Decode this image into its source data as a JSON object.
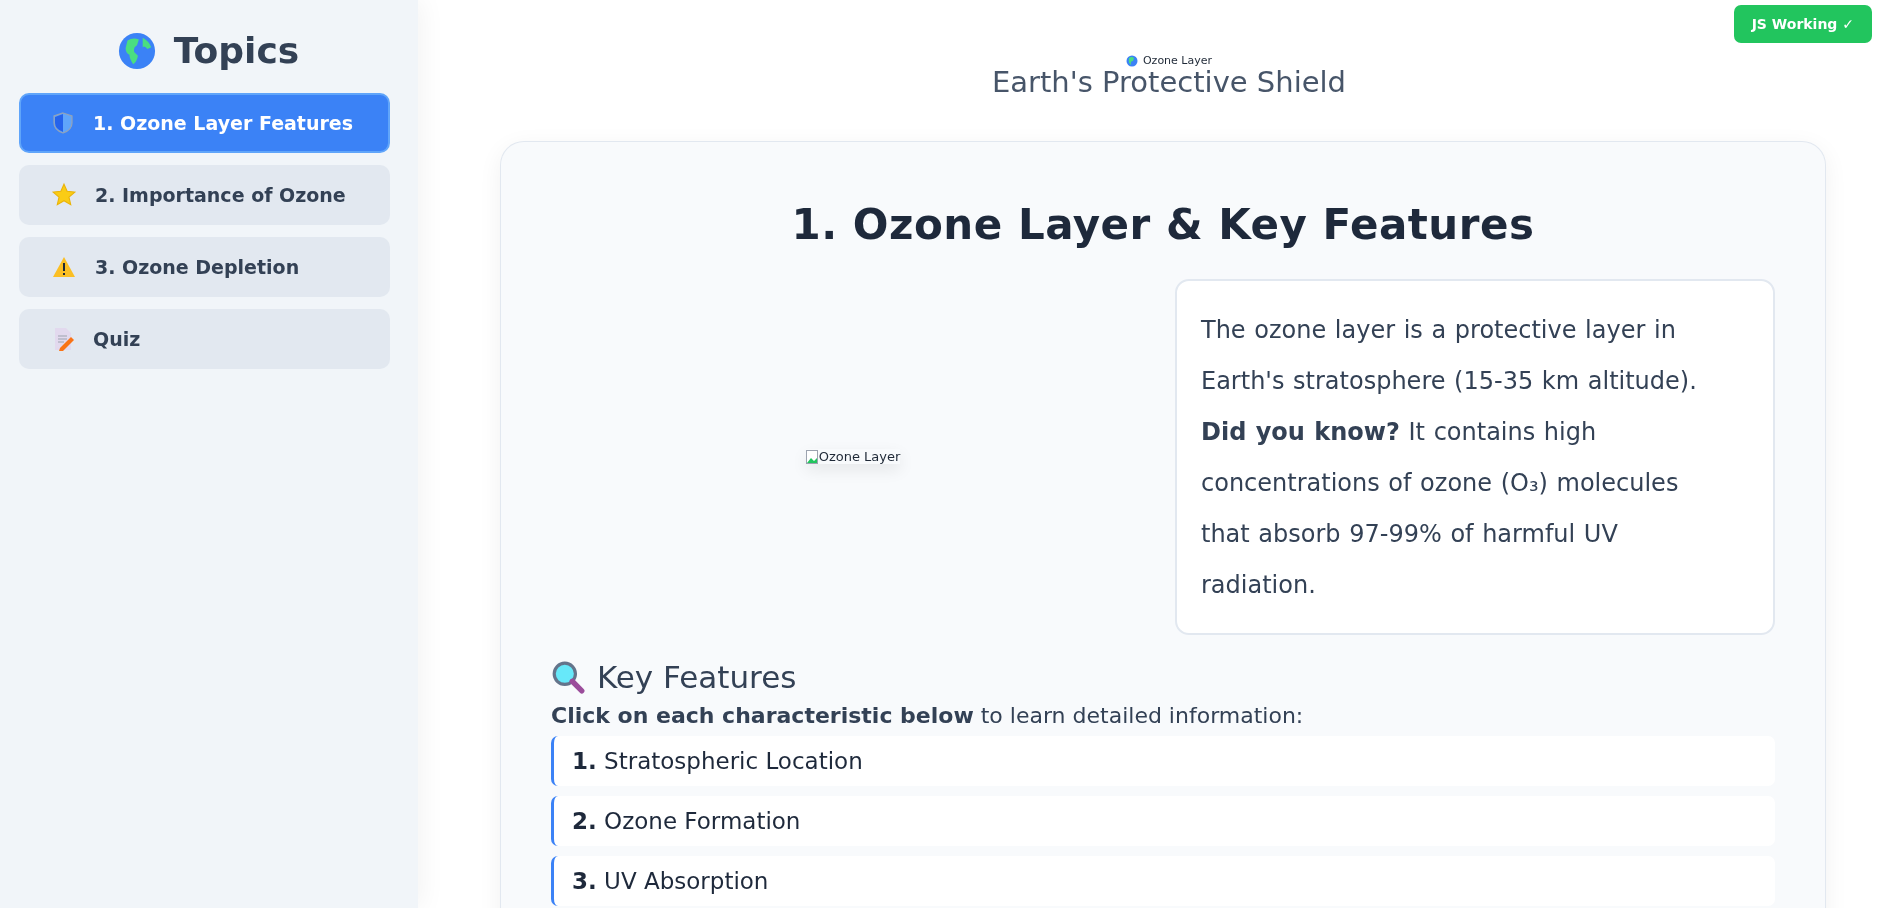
{
  "sidebar": {
    "title": "Topics",
    "items": [
      {
        "label": "1. Ozone Layer Features",
        "kind": "shield",
        "selected": true
      },
      {
        "label": "2. Importance of Ozone",
        "kind": "star",
        "selected": false
      },
      {
        "label": "3. Ozone Depletion",
        "kind": "warning",
        "selected": false
      },
      {
        "label": "Quiz",
        "kind": "memo",
        "selected": false
      }
    ]
  },
  "status_badge": "JS Working ✓",
  "header": {
    "image_alt": "Ozone Layer",
    "title": "Earth's Protective Shield"
  },
  "section": {
    "title": "1. Ozone Layer & Key Features",
    "image_alt": "Ozone Layer",
    "info": "The ozone layer is a protective layer in Earth's stratosphere (15-35 km altitude). **Did you know?** It contains high concentrations of ozone (O₃) molecules that absorb 97-99% of harmful UV radiation.",
    "features_title": "Key Features",
    "instruction": "**Click on each characteristic below** to learn detailed information:",
    "features": [
      {
        "number": "1.",
        "label": "Stratospheric Location"
      },
      {
        "number": "2.",
        "label": "Ozone Formation"
      },
      {
        "number": "3.",
        "label": "UV Absorption"
      }
    ]
  }
}
